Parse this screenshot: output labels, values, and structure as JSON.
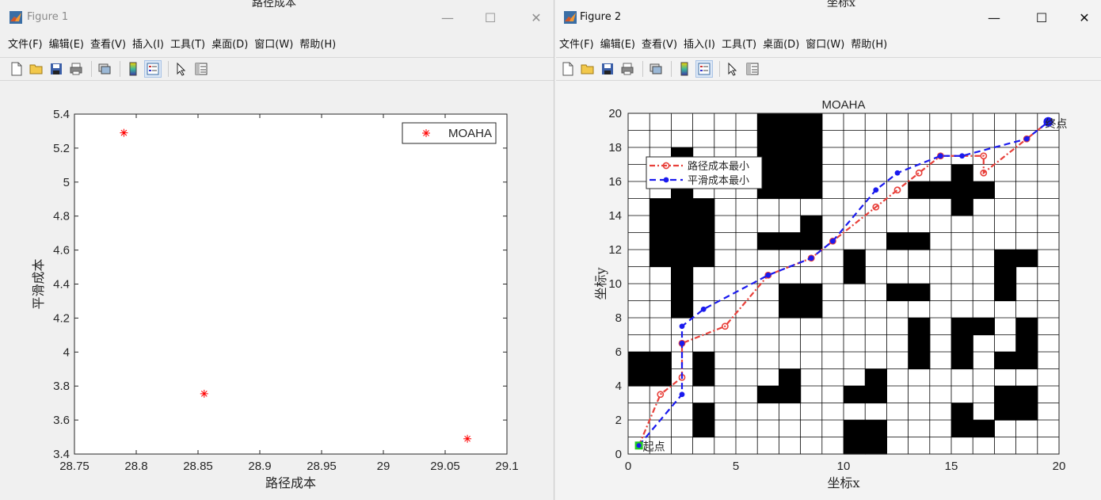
{
  "figure1": {
    "title": "Figure 1",
    "peek_text": "路径成本",
    "controls": {
      "minimize": "—",
      "maximize": "☐",
      "close": "✕"
    },
    "menu": [
      "文件(F)",
      "编辑(E)",
      "查看(V)",
      "插入(I)",
      "工具(T)",
      "桌面(D)",
      "窗口(W)",
      "帮助(H)"
    ],
    "toolbar_icons": [
      "new-figure-icon",
      "open-file-icon",
      "save-icon",
      "print-icon",
      "link-plot-icon",
      "colorbar-icon",
      "legend-icon",
      "edit-plot-icon",
      "property-inspector-icon"
    ],
    "chart_data": {
      "type": "scatter",
      "xlabel": "路径成本",
      "ylabel": "平滑成本",
      "xlim": [
        28.75,
        29.1
      ],
      "ylim": [
        3.4,
        5.4
      ],
      "xticks": [
        "28.75",
        "28.8",
        "28.85",
        "28.9",
        "28.95",
        "29",
        "29.05",
        "29.1"
      ],
      "yticks": [
        "3.4",
        "3.6",
        "3.8",
        "4",
        "4.2",
        "4.4",
        "4.6",
        "4.8",
        "5",
        "5.2",
        "5.4"
      ],
      "legend": {
        "label": "MOAHA",
        "placement": "top-right"
      },
      "series": [
        {
          "name": "MOAHA",
          "color": "#ff0000",
          "marker": "*",
          "points": [
            [
              28.79,
              5.29
            ],
            [
              28.855,
              3.755
            ],
            [
              29.068,
              3.49
            ]
          ]
        }
      ],
      "grid": false
    }
  },
  "figure2": {
    "title": "Figure 2",
    "peek_text": "坐标x",
    "controls": {
      "minimize": "—",
      "maximize": "☐",
      "close": "✕"
    },
    "menu": [
      "文件(F)",
      "编辑(E)",
      "查看(V)",
      "插入(I)",
      "工具(T)",
      "桌面(D)",
      "窗口(W)",
      "帮助(H)"
    ],
    "toolbar_icons": [
      "new-figure-icon",
      "open-file-icon",
      "save-icon",
      "print-icon",
      "link-plot-icon",
      "colorbar-icon",
      "legend-icon",
      "edit-plot-icon",
      "property-inspector-icon"
    ],
    "chart_data": {
      "type": "line",
      "title": "MOAHA",
      "xlabel": "坐标x",
      "ylabel": "坐标y",
      "xlim": [
        0,
        20
      ],
      "ylim": [
        0,
        20
      ],
      "xticks": [
        "0",
        "5",
        "10",
        "15",
        "20"
      ],
      "yticks": [
        "0",
        "2",
        "4",
        "6",
        "8",
        "10",
        "12",
        "14",
        "16",
        "18",
        "20"
      ],
      "grid": true,
      "grid_cell_size": 1,
      "legend": {
        "placement": "top-left"
      },
      "start_label": "起点",
      "end_label": "终点",
      "start_point": [
        0.5,
        0.5
      ],
      "end_point": [
        19.5,
        19.5
      ],
      "obstacles": [
        [
          0,
          4
        ],
        [
          0,
          5
        ],
        [
          1,
          4
        ],
        [
          1,
          5
        ],
        [
          1,
          11
        ],
        [
          1,
          12
        ],
        [
          1,
          13
        ],
        [
          1,
          14
        ],
        [
          2,
          8
        ],
        [
          2,
          9
        ],
        [
          2,
          10
        ],
        [
          2,
          11
        ],
        [
          2,
          12
        ],
        [
          2,
          13
        ],
        [
          2,
          14
        ],
        [
          2,
          15
        ],
        [
          2,
          16
        ],
        [
          2,
          17
        ],
        [
          3,
          1
        ],
        [
          3,
          2
        ],
        [
          3,
          4
        ],
        [
          3,
          5
        ],
        [
          3,
          11
        ],
        [
          3,
          12
        ],
        [
          3,
          13
        ],
        [
          3,
          14
        ],
        [
          6,
          3
        ],
        [
          6,
          12
        ],
        [
          6,
          15
        ],
        [
          6,
          16
        ],
        [
          6,
          17
        ],
        [
          6,
          18
        ],
        [
          6,
          19
        ],
        [
          7,
          3
        ],
        [
          7,
          4
        ],
        [
          7,
          12
        ],
        [
          7,
          15
        ],
        [
          7,
          16
        ],
        [
          7,
          17
        ],
        [
          7,
          18
        ],
        [
          7,
          19
        ],
        [
          7,
          8
        ],
        [
          7,
          9
        ],
        [
          8,
          8
        ],
        [
          8,
          9
        ],
        [
          8,
          12
        ],
        [
          8,
          13
        ],
        [
          8,
          15
        ],
        [
          8,
          16
        ],
        [
          8,
          17
        ],
        [
          8,
          18
        ],
        [
          8,
          19
        ],
        [
          10,
          0
        ],
        [
          10,
          1
        ],
        [
          10,
          3
        ],
        [
          10,
          10
        ],
        [
          10,
          11
        ],
        [
          11,
          0
        ],
        [
          11,
          1
        ],
        [
          11,
          3
        ],
        [
          11,
          4
        ],
        [
          12,
          9
        ],
        [
          12,
          12
        ],
        [
          13,
          5
        ],
        [
          13,
          6
        ],
        [
          13,
          7
        ],
        [
          13,
          9
        ],
        [
          13,
          12
        ],
        [
          13,
          15
        ],
        [
          14,
          15
        ],
        [
          15,
          1
        ],
        [
          15,
          2
        ],
        [
          15,
          14
        ],
        [
          15,
          15
        ],
        [
          15,
          16
        ],
        [
          16,
          1
        ],
        [
          16,
          15
        ],
        [
          15,
          5
        ],
        [
          15,
          6
        ],
        [
          15,
          7
        ],
        [
          16,
          7
        ],
        [
          17,
          2
        ],
        [
          17,
          3
        ],
        [
          17,
          9
        ],
        [
          17,
          10
        ],
        [
          17,
          11
        ],
        [
          18,
          2
        ],
        [
          18,
          3
        ],
        [
          18,
          5
        ],
        [
          18,
          6
        ],
        [
          18,
          7
        ],
        [
          18,
          11
        ],
        [
          17,
          5
        ]
      ],
      "series": [
        {
          "name": "路径成本最小",
          "color": "#e8403a",
          "style": "dash-dot",
          "marker": "circle",
          "x": [
            0.5,
            1.5,
            2.5,
            2.5,
            4.5,
            6.5,
            8.5,
            9.5,
            11.5,
            12.5,
            13.5,
            14.5,
            16.5,
            16.5,
            18.5,
            19.5
          ],
          "y": [
            0.5,
            3.5,
            4.5,
            6.5,
            7.5,
            10.5,
            11.5,
            12.5,
            14.5,
            15.5,
            16.5,
            17.5,
            17.5,
            16.5,
            18.5,
            19.5
          ]
        },
        {
          "name": "平滑成本最小",
          "color": "#1a1aee",
          "style": "dash",
          "marker": "dot",
          "x": [
            0.5,
            2.5,
            2.5,
            2.5,
            3.5,
            6.5,
            8.5,
            9.5,
            11.5,
            12.5,
            14.5,
            15.5,
            18.5,
            19.5
          ],
          "y": [
            0.5,
            3.5,
            6.5,
            7.5,
            8.5,
            10.5,
            11.5,
            12.5,
            15.5,
            16.5,
            17.5,
            17.5,
            18.5,
            19.5
          ]
        }
      ]
    }
  }
}
